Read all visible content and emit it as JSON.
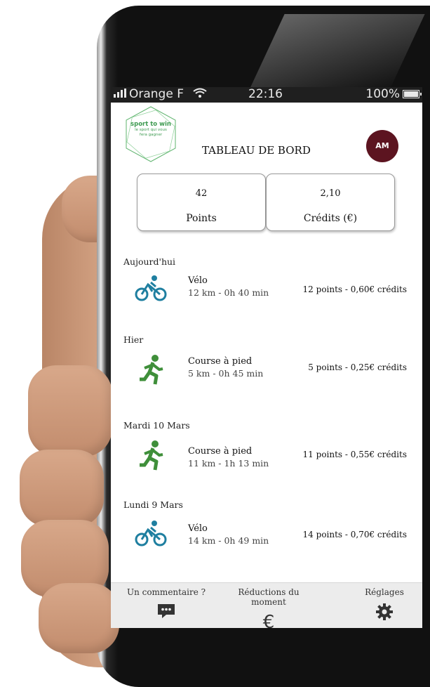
{
  "status_bar": {
    "carrier": "Orange F",
    "time": "22:16",
    "battery": "100%"
  },
  "logo": {
    "name": "sport to win",
    "tagline_1": "le sport qui vous",
    "tagline_2": "fera gagner"
  },
  "header": {
    "title": "TABLEAU DE BORD",
    "avatar_initials": "AM"
  },
  "stats": {
    "points": {
      "value": "42",
      "label": "Points"
    },
    "credits": {
      "value": "2,10",
      "label": "Crédits (€)"
    }
  },
  "activities": [
    {
      "day": "Aujourd'hui",
      "sport": "bike",
      "name": "Vélo",
      "detail": "12 km - 0h 40 min",
      "score": "12 points - 0,60€ crédits"
    },
    {
      "day": "Hier",
      "sport": "run",
      "name": "Course à pied",
      "detail": "5 km - 0h 45 min",
      "score": "5 points - 0,25€ crédits"
    },
    {
      "day": "Mardi 10 Mars",
      "sport": "run",
      "name": "Course à pied",
      "detail": "11 km - 1h 13 min",
      "score": "11 points - 0,55€ crédits"
    },
    {
      "day": "Lundi 9 Mars",
      "sport": "bike",
      "name": "Vélo",
      "detail": "14 km - 0h 49 min",
      "score": "14 points - 0,70€ crédits"
    }
  ],
  "bottom_nav": {
    "comment_label": "Un commentaire ?",
    "reductions_label": "Réductions du moment",
    "settings_label": "Réglages",
    "euro_symbol": "€"
  },
  "colors": {
    "logo_green": "#3f9b52",
    "avatar": "#5c1420",
    "bike_blue": "#1f7fa0",
    "run_green": "#3f8f3a"
  },
  "icons": {
    "bike": "bicycle-icon",
    "run": "runner-icon",
    "comment": "speech-bubble-icon",
    "settings": "gear-icon"
  }
}
